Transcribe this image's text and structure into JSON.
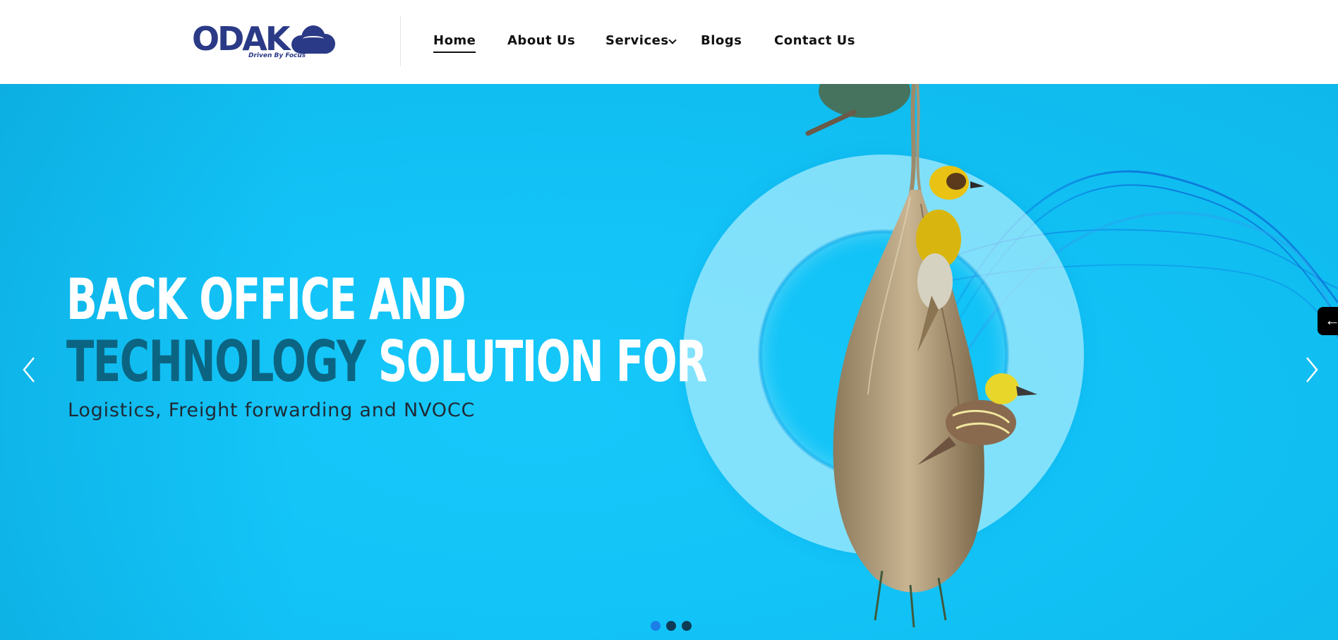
{
  "brand": {
    "logo_text": "ODAK",
    "tagline": "Driven By Focus",
    "color": "#2b3a86"
  },
  "nav": {
    "items": [
      {
        "label": "Home",
        "active": true
      },
      {
        "label": "About Us",
        "active": false
      },
      {
        "label": "Services",
        "active": false,
        "has_dropdown": true
      },
      {
        "label": "Blogs",
        "active": false
      },
      {
        "label": "Contact Us",
        "active": false
      }
    ]
  },
  "hero": {
    "line1": "BACK OFFICE AND",
    "line2_highlight": "TECHNOLOGY",
    "line2_rest": "SOLUTION FOR",
    "subtitle": "Logistics, Freight forwarding and NVOCC",
    "background_color": "#14c4f8",
    "highlight_color": "#0b6582",
    "prev_icon": "chevron-left-icon",
    "next_icon": "chevron-right-icon",
    "side_tab_glyph": "←",
    "slides": [
      {
        "active": true
      },
      {
        "active": false
      },
      {
        "active": false
      }
    ]
  }
}
